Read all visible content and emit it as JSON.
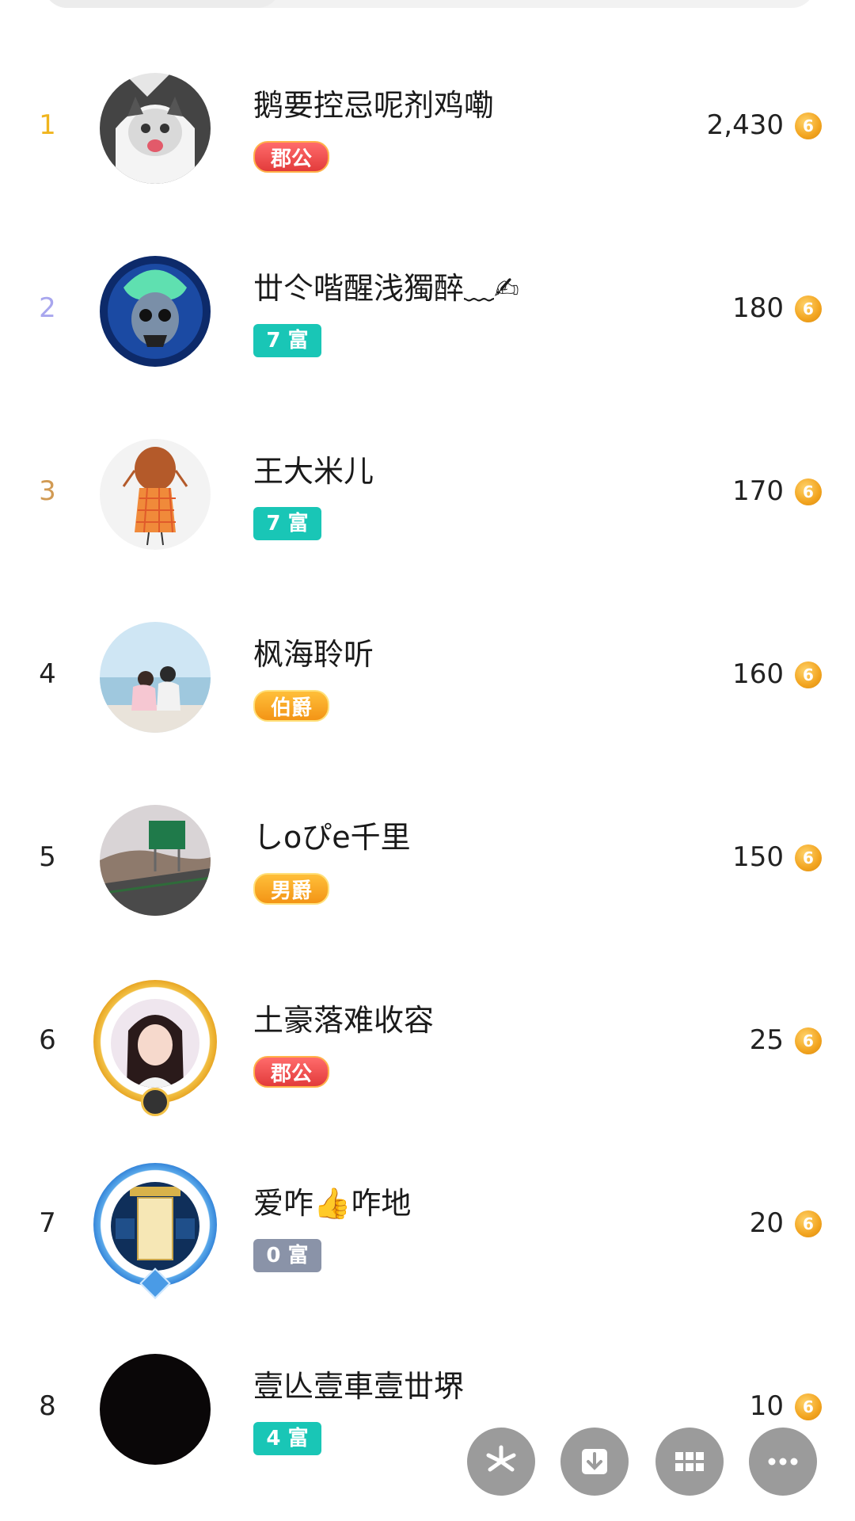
{
  "leaderboard": [
    {
      "rank": "1",
      "name": "鹅要控忌呢剂鸡嘞",
      "badge": "郡公",
      "badge_type": "title-red",
      "amount": "2,430",
      "coin_glyph": "6"
    },
    {
      "rank": "2",
      "name": "丗仒喈醒浅獨醉﹏✍",
      "badge": "7 富",
      "badge_type": "rich",
      "amount": "180",
      "coin_glyph": "6"
    },
    {
      "rank": "3",
      "name": "王大米儿",
      "badge": "7 富",
      "badge_type": "rich",
      "amount": "170",
      "coin_glyph": "6"
    },
    {
      "rank": "4",
      "name": "枫海聆听",
      "badge": "伯爵",
      "badge_type": "title-orange",
      "amount": "160",
      "coin_glyph": "6"
    },
    {
      "rank": "5",
      "name": "しoぴe千里",
      "badge": "男爵",
      "badge_type": "title-orange",
      "amount": "150",
      "coin_glyph": "6"
    },
    {
      "rank": "6",
      "name": "土豪落难收容",
      "badge": "郡公",
      "badge_type": "title-red",
      "amount": "25",
      "coin_glyph": "6"
    },
    {
      "rank": "7",
      "name": "爱咋👍咋地",
      "badge": "0 富",
      "badge_type": "rich-grey",
      "amount": "20",
      "coin_glyph": "6"
    },
    {
      "rank": "8",
      "name": "壹亾壹車壹丗堺",
      "badge": "4 富",
      "badge_type": "rich",
      "amount": "10",
      "coin_glyph": "6"
    }
  ],
  "fab_buttons": [
    {
      "icon": "pinwheel-icon"
    },
    {
      "icon": "download-icon"
    },
    {
      "icon": "grid-icon"
    },
    {
      "icon": "more-icon"
    }
  ],
  "colors": {
    "gold": "#f0b51e",
    "silver": "#a8a6ee",
    "bronze": "#d19a53",
    "rich_badge": "#19c6b6"
  }
}
